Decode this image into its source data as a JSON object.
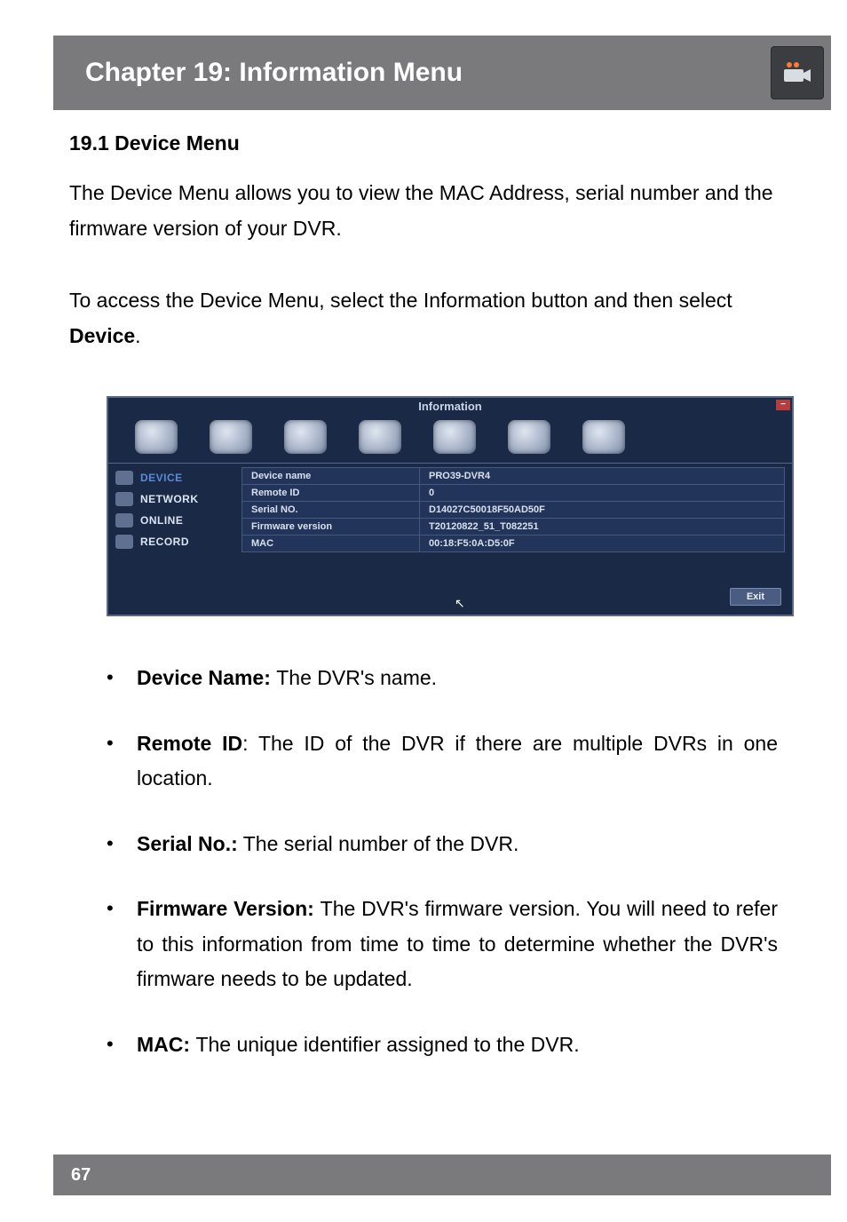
{
  "header": {
    "title": "Chapter 19: Information Menu"
  },
  "section": {
    "heading": "19.1 Device Menu"
  },
  "para1": "The Device Menu allows you to view the MAC Address, serial number and the firmware version of your DVR.",
  "para2_a": "To access the Device Menu, select the Information button and then select ",
  "para2_b": "Device",
  "para2_c": ".",
  "screenshot": {
    "title": "Information",
    "sidebar": [
      "DEVICE",
      "NETWORK",
      "ONLINE",
      "RECORD"
    ],
    "rows": [
      {
        "label": "Device name",
        "value": "PRO39-DVR4"
      },
      {
        "label": "Remote ID",
        "value": "0"
      },
      {
        "label": "Serial NO.",
        "value": "D14027C50018F50AD50F"
      },
      {
        "label": "Firmware version",
        "value": "T20120822_51_T082251"
      },
      {
        "label": "MAC",
        "value": "00:18:F5:0A:D5:0F"
      }
    ],
    "exit": "Exit"
  },
  "bullets": [
    {
      "b": "Device Name: ",
      "t": "The DVR's name."
    },
    {
      "b": "Remote ID",
      "t": ": The ID of the DVR if there are multiple DVRs in one location."
    },
    {
      "b": "Serial No.:",
      "t": " The serial number of the DVR."
    },
    {
      "b": "Firmware Version: ",
      "t": "The DVR's firmware version. You will need to refer to this information from time to time to determine whether the DVR's firmware needs to be updated."
    },
    {
      "b": "MAC: ",
      "t": "The unique identifier assigned to the DVR."
    }
  ],
  "page_number": "67"
}
